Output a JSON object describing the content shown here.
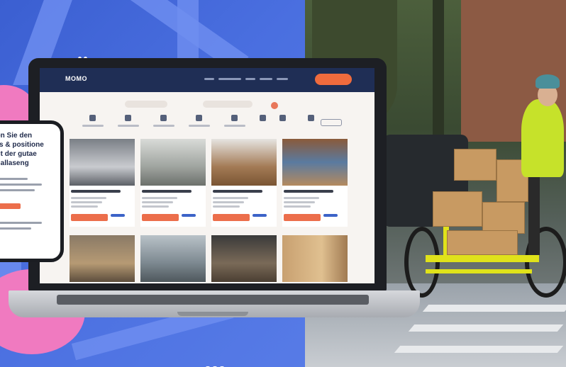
{
  "site": {
    "logo": "MOMO"
  },
  "phone": {
    "lines": [
      "den Sie den",
      "ors & positione",
      "mit der gutae",
      "ehallaseng"
    ]
  },
  "colors": {
    "map_blue": "#3b5fd1",
    "brand_orange": "#ef6b3d",
    "header_navy": "#1f2e55",
    "bike_yellow": "#e0e21a"
  },
  "icons": [
    "home-icon",
    "warehouse-icon",
    "office-icon",
    "search-icon",
    "filter-icon"
  ]
}
